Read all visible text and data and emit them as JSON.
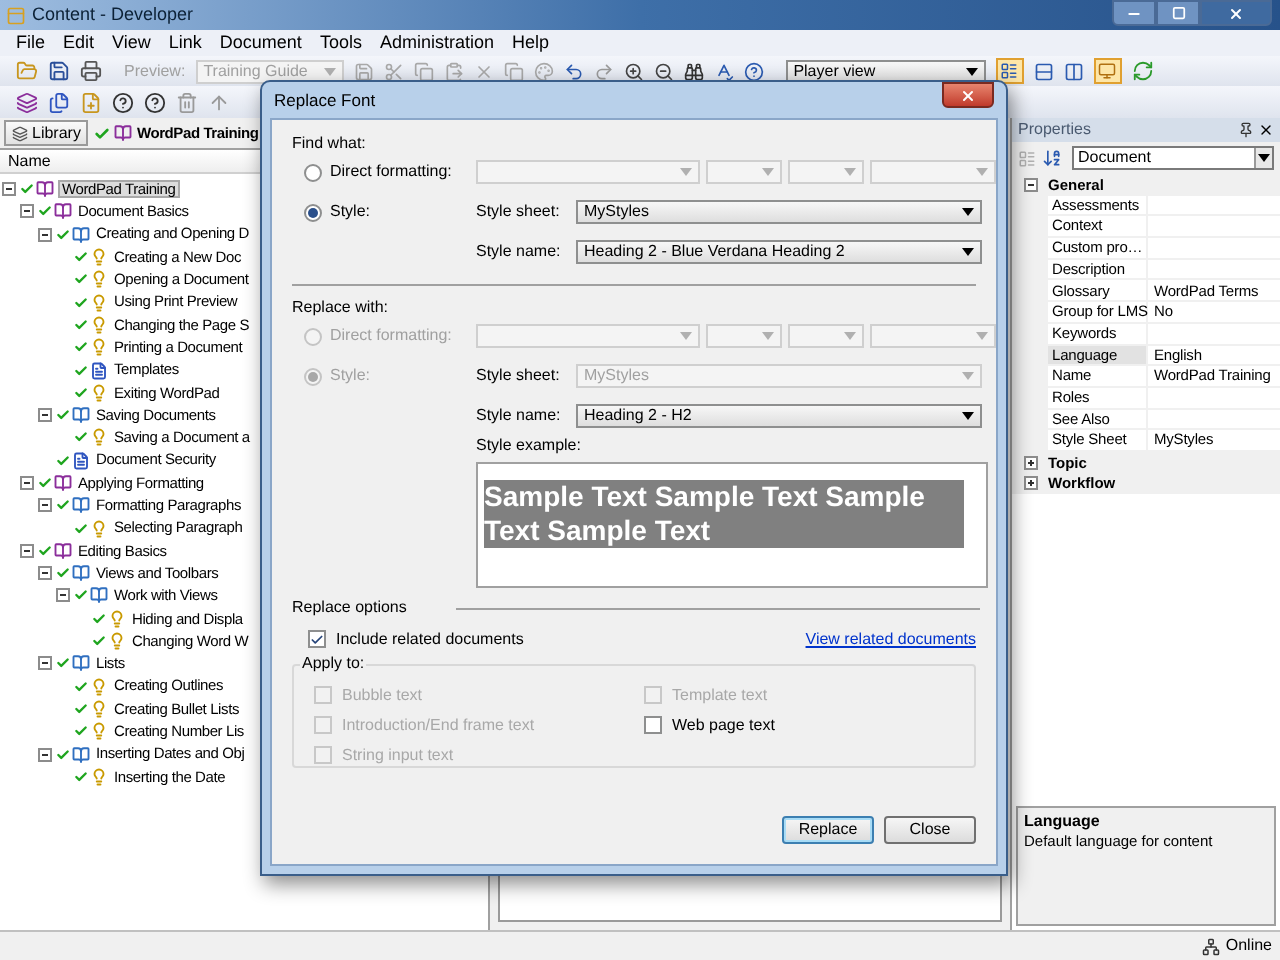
{
  "window": {
    "title": "Content - Developer"
  },
  "menu": [
    "File",
    "Edit",
    "View",
    "Link",
    "Document",
    "Tools",
    "Administration",
    "Help"
  ],
  "toolbar": {
    "preview_label": "Preview:",
    "preview_value": "Training Guide",
    "view_value": "Player view"
  },
  "tabs": [
    {
      "label": "Library",
      "selected": false
    },
    {
      "label": "WordPad Training",
      "selected": true
    }
  ],
  "tree": {
    "header": "Name",
    "items": [
      {
        "label": "WordPad Training",
        "kind": "module",
        "selected": true,
        "expanded": true,
        "children": [
          {
            "label": "Document Basics",
            "kind": "module",
            "selected": false,
            "expanded": true,
            "children": [
              {
                "label": "Creating and Opening D",
                "kind": "section",
                "selected": false,
                "expanded": true,
                "children": [
                  {
                    "label": "Creating a New Doc",
                    "kind": "topic",
                    "selected": false
                  },
                  {
                    "label": "Opening a Document",
                    "kind": "topic",
                    "selected": false
                  },
                  {
                    "label": "Using Print Preview",
                    "kind": "topic",
                    "selected": false
                  },
                  {
                    "label": "Changing the Page S",
                    "kind": "topic",
                    "selected": false
                  },
                  {
                    "label": "Printing a Document",
                    "kind": "topic",
                    "selected": false
                  },
                  {
                    "label": "Templates",
                    "kind": "document",
                    "selected": false
                  },
                  {
                    "label": "Exiting WordPad",
                    "kind": "topic",
                    "selected": false
                  }
                ]
              },
              {
                "label": "Saving Documents",
                "kind": "section",
                "selected": false,
                "expanded": true,
                "children": [
                  {
                    "label": "Saving a Document a",
                    "kind": "topic",
                    "selected": false
                  }
                ]
              },
              {
                "label": "Document Security",
                "kind": "document",
                "selected": false
              }
            ]
          },
          {
            "label": "Applying Formatting",
            "kind": "module",
            "selected": false,
            "expanded": true,
            "children": [
              {
                "label": "Formatting Paragraphs",
                "kind": "section",
                "selected": false,
                "expanded": true,
                "children": [
                  {
                    "label": "Selecting Paragraph",
                    "kind": "topic",
                    "selected": false
                  }
                ]
              }
            ]
          },
          {
            "label": "Editing Basics",
            "kind": "module",
            "selected": false,
            "expanded": true,
            "children": [
              {
                "label": "Views and Toolbars",
                "kind": "section",
                "selected": false,
                "expanded": true,
                "children": [
                  {
                    "label": "Work with Views",
                    "kind": "section",
                    "selected": false,
                    "expanded": true,
                    "children": [
                      {
                        "label": "Hiding and Displa",
                        "kind": "topic",
                        "selected": false
                      },
                      {
                        "label": "Changing Word W",
                        "kind": "topic",
                        "selected": false
                      }
                    ]
                  }
                ]
              },
              {
                "label": "Lists",
                "kind": "section",
                "selected": false,
                "expanded": true,
                "children": [
                  {
                    "label": "Creating Outlines",
                    "kind": "topic",
                    "selected": false
                  },
                  {
                    "label": "Creating Bullet Lists",
                    "kind": "topic",
                    "selected": false
                  },
                  {
                    "label": "Creating Number Lis",
                    "kind": "topic",
                    "selected": false
                  }
                ]
              },
              {
                "label": "Inserting Dates and Obj",
                "kind": "section",
                "selected": false,
                "expanded": true,
                "children": [
                  {
                    "label": "Inserting the Date",
                    "kind": "topic",
                    "selected": false
                  }
                ]
              }
            ]
          }
        ]
      }
    ]
  },
  "properties": {
    "title": "Properties",
    "category": "Document",
    "groups": [
      {
        "name": "General",
        "expanded": true,
        "rows": [
          {
            "name": "Assessments",
            "selected": false
          },
          {
            "name": "Context",
            "selected": false
          },
          {
            "name": "Custom pro…",
            "selected": false
          },
          {
            "name": "Description",
            "selected": false
          },
          {
            "name": "Glossary",
            "value": "WordPad Terms",
            "selected": false
          },
          {
            "name": "Group for LMS",
            "value": "No",
            "selected": false
          },
          {
            "name": "Keywords",
            "selected": false
          },
          {
            "name": "Language",
            "value": "English",
            "selected": true
          },
          {
            "name": "Name",
            "value": "WordPad Training",
            "selected": false
          },
          {
            "name": "Roles",
            "selected": false
          },
          {
            "name": "See Also",
            "selected": false
          },
          {
            "name": "Style Sheet",
            "value": "MyStyles",
            "selected": false
          }
        ]
      },
      {
        "name": "Topic",
        "expanded": false
      },
      {
        "name": "Workflow",
        "expanded": false
      }
    ],
    "description": {
      "title": "Language",
      "text": "Default language for content"
    }
  },
  "dialog": {
    "title": "Replace Font",
    "find": {
      "label": "Find what:",
      "direct": {
        "label": "Direct formatting:",
        "selected": false,
        "disabled": false
      },
      "style": {
        "label": "Style:",
        "selected": true,
        "disabled": false
      },
      "style_sheet": {
        "label": "Style sheet:",
        "value": "MyStyles",
        "disabled": false
      },
      "style_name": {
        "label": "Style name:",
        "value": "Heading 2 - Blue Verdana Heading 2",
        "disabled": false
      }
    },
    "replace": {
      "label": "Replace with:",
      "direct": {
        "label": "Direct formatting:",
        "selected": false,
        "disabled": true
      },
      "style": {
        "label": "Style:",
        "selected": true,
        "disabled": true
      },
      "style_sheet": {
        "label": "Style sheet:",
        "value": "MyStyles",
        "disabled": true
      },
      "style_name": {
        "label": "Style name:",
        "value": "Heading 2 - H2",
        "disabled": false
      }
    },
    "example": {
      "label": "Style example:",
      "text": "Sample Text Sample Text Sample Text Sample Text"
    },
    "options": {
      "label": "Replace options",
      "include": {
        "label": "Include related documents",
        "checked": true
      },
      "link": "View related documents"
    },
    "apply_to": {
      "label": "Apply to:",
      "items": [
        {
          "label": "Bubble text",
          "checked": false,
          "disabled": true
        },
        {
          "label": "Template text",
          "checked": false,
          "disabled": true
        },
        {
          "label": "Introduction/End frame text",
          "checked": false,
          "disabled": true
        },
        {
          "label": "Web page text",
          "checked": false,
          "disabled": false
        },
        {
          "label": "String input text",
          "checked": false,
          "disabled": true
        }
      ]
    },
    "buttons": [
      "Replace",
      "Close"
    ]
  },
  "status_bar": {
    "connection": "Online"
  }
}
